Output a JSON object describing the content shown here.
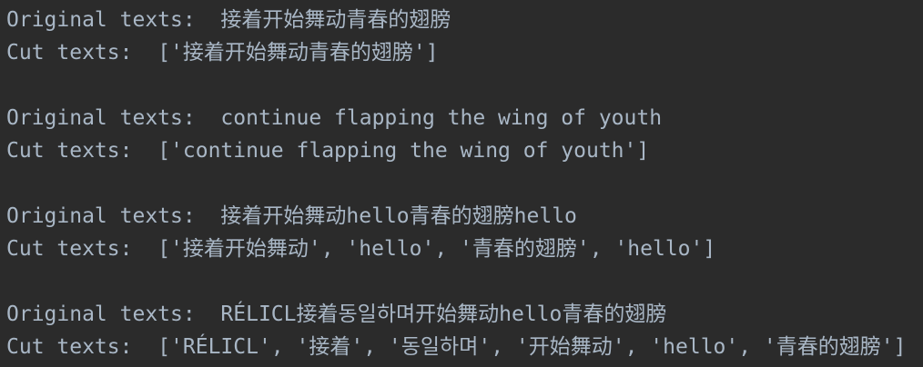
{
  "blocks": [
    {
      "original_label": "Original texts:",
      "original_value": "接着开始舞动青春的翅膀",
      "cut_label": "Cut texts:",
      "cut_value": "['接着开始舞动青春的翅膀']"
    },
    {
      "original_label": "Original texts:",
      "original_value": "continue flapping the wing of youth",
      "cut_label": "Cut texts:",
      "cut_value": "['continue flapping the wing of youth']"
    },
    {
      "original_label": "Original texts:",
      "original_value": "接着开始舞动hello青春的翅膀hello",
      "cut_label": "Cut texts:",
      "cut_value": "['接着开始舞动', 'hello', '青春的翅膀', 'hello']"
    },
    {
      "original_label": "Original texts:",
      "original_value": "RÉLICL接着동일하며开始舞动hello青春的翅膀",
      "cut_label": "Cut texts:",
      "cut_value": "['RÉLICL', '接着', '동일하며', '开始舞动', 'hello', '青春的翅膀']"
    }
  ]
}
